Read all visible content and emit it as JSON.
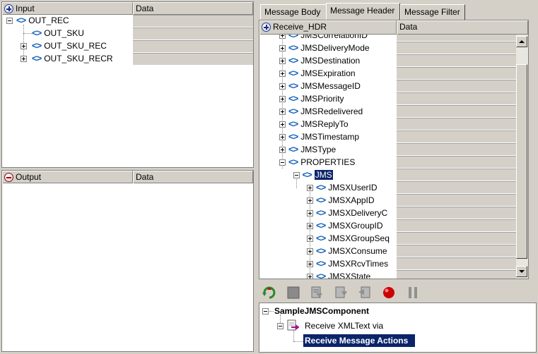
{
  "input_panel": {
    "header_label": "Input",
    "data_label": "Data",
    "nodes": [
      "OUT_REC",
      "OUT_SKU",
      "OUT_SKU_REC",
      "OUT_SKU_RECR"
    ]
  },
  "output_panel": {
    "header_label": "Output",
    "data_label": "Data"
  },
  "tabs": [
    "Message Body",
    "Message Header",
    "Message Filter"
  ],
  "header_tree": {
    "root_label": "Receive_HDR",
    "data_label": "Data",
    "partial_top": "JMSCorrelationID",
    "items": [
      "JMSDeliveryMode",
      "JMSDestination",
      "JMSExpiration",
      "JMSMessageID",
      "JMSPriority",
      "JMSRedelivered",
      "JMSReplyTo",
      "JMSTimestamp",
      "JMSType",
      "PROPERTIES"
    ],
    "jms_label": "JMS",
    "sub_items": [
      "JMSXUserID",
      "JMSXAppID",
      "JMSXDeliveryC",
      "JMSXGroupID",
      "JMSXGroupSeq",
      "JMSXConsume",
      "JMSXRcvTimes"
    ],
    "partial_bottom": "JMSXState"
  },
  "toolbar": {
    "icons": [
      "refresh-icon",
      "stop-icon",
      "step-icon",
      "step-into-icon",
      "step-out-icon",
      "record-icon",
      "pause-icon"
    ]
  },
  "component_tree": {
    "root": "SampleJMSComponent",
    "child": "Receive XMLText via",
    "action": "Receive Message Actions"
  },
  "colors": {
    "tag_blue": "#1560b8",
    "selection": "#0a246a",
    "record_red": "#cc0000"
  }
}
